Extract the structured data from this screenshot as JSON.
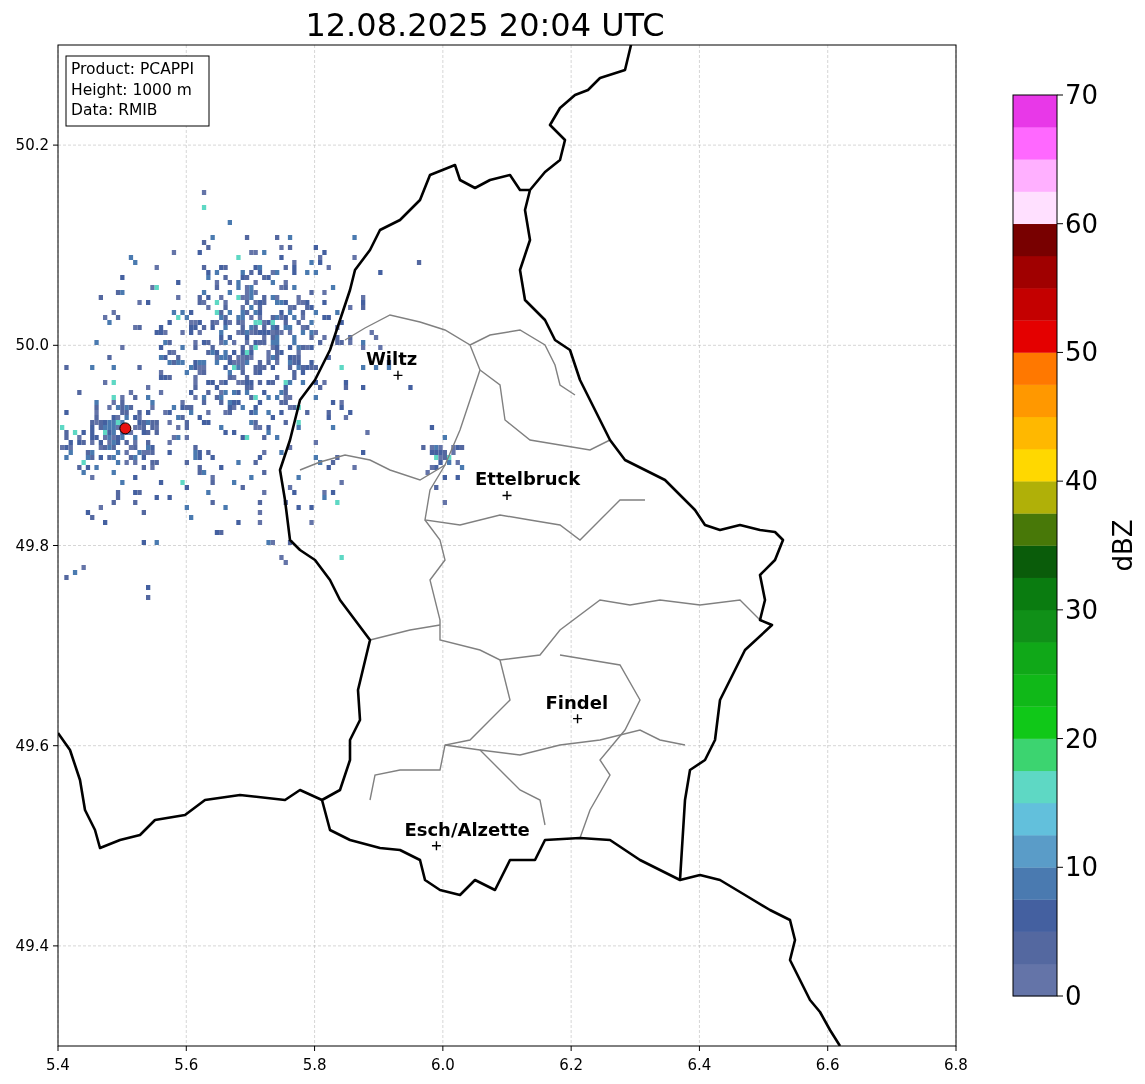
{
  "title": "12.08.2025 20:04 UTC",
  "info_box": [
    "Product: PCAPPI",
    "Height: 1000 m",
    "Data: RMIB"
  ],
  "map": {
    "xticks": [
      "5.4",
      "5.6",
      "5.8",
      "6.0",
      "6.2",
      "6.4",
      "6.6",
      "6.8"
    ],
    "yticks": [
      "50.2",
      "50.0",
      "49.8",
      "49.6",
      "49.4"
    ],
    "cities": [
      {
        "name": "Wiltz"
      },
      {
        "name": "Ettelbruck"
      },
      {
        "name": "Findel"
      },
      {
        "name": "Esch/Alzette"
      }
    ]
  },
  "colorbar": {
    "label": "dBZ",
    "ticks": [
      "70",
      "60",
      "50",
      "40",
      "30",
      "20",
      "10",
      "0"
    ],
    "bins": [
      {
        "color": "#6474a8"
      },
      {
        "color": "#5468a0"
      },
      {
        "color": "#4460a0"
      },
      {
        "color": "#4a7ab0"
      },
      {
        "color": "#5a9cc8"
      },
      {
        "color": "#62c0dc"
      },
      {
        "color": "#5ed8c4"
      },
      {
        "color": "#3cd470"
      },
      {
        "color": "#10c818"
      },
      {
        "color": "#10b818"
      },
      {
        "color": "#10a818"
      },
      {
        "color": "#109018"
      },
      {
        "color": "#0a7c10"
      },
      {
        "color": "#0a5c0a"
      },
      {
        "color": "#487808"
      },
      {
        "color": "#b0b008"
      },
      {
        "color": "#ffd800"
      },
      {
        "color": "#ffb800"
      },
      {
        "color": "#ff9800"
      },
      {
        "color": "#ff7800"
      },
      {
        "color": "#e40000"
      },
      {
        "color": "#c40000"
      },
      {
        "color": "#a00000"
      },
      {
        "color": "#780000"
      },
      {
        "color": "#ffe0ff"
      },
      {
        "color": "#ffb0ff"
      },
      {
        "color": "#ff68ff"
      },
      {
        "color": "#e838e8"
      }
    ]
  }
}
